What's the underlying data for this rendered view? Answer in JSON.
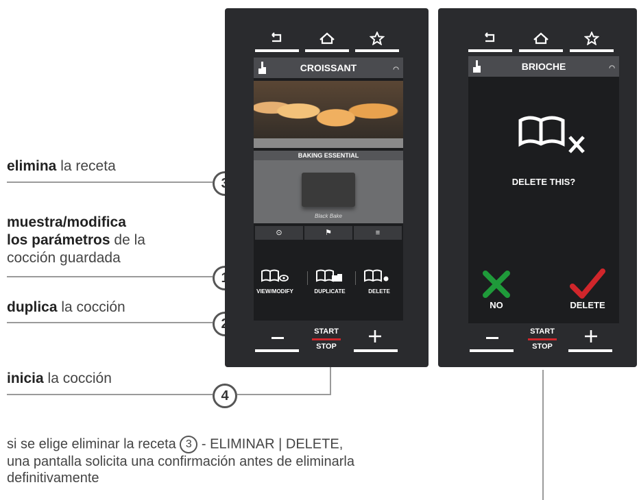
{
  "annotations": {
    "delete": {
      "bold": "elimina",
      "rest": " la receta",
      "num": "3"
    },
    "view": {
      "bold_lines": [
        "muestra/modifica",
        "los parámetros"
      ],
      "rest_line2": " de la",
      "line3": "cocción guardada",
      "num": "1"
    },
    "duplicate": {
      "bold": "duplica",
      "rest": " la cocción",
      "num": "2"
    },
    "start": {
      "bold": "inicia",
      "rest": " la cocción",
      "num": "4"
    }
  },
  "footnote": {
    "part1": "si se elige eliminar la receta",
    "num": "3",
    "part2": " - ELIMINAR | DELETE,",
    "line2": "una pantalla solicita una confirmación antes de eliminarla",
    "line3": "definitivamente"
  },
  "left_device": {
    "title": "CROISSANT",
    "section_label": "BAKING ESSENTIAL",
    "tray_logo": "Black Bake",
    "actions": [
      "VIEW/MODIFY",
      "DUPLICATE",
      "DELETE"
    ],
    "start_label": "START",
    "stop_label": "STOP"
  },
  "right_device": {
    "title": "BRIOCHE",
    "prompt": "DELETE THIS?",
    "no_label": "NO",
    "delete_label": "DELETE",
    "start_label": "START",
    "stop_label": "STOP"
  },
  "colors": {
    "device": "#2a2b2e",
    "confirm_red": "#d0262b",
    "cancel_green": "#1f9a3a"
  },
  "icons": [
    "back-icon",
    "home-icon",
    "star-icon",
    "hand-icon",
    "wifi-icon",
    "book-delete-icon",
    "x-cross-icon",
    "checkmark-icon",
    "minus-icon",
    "plus-icon"
  ]
}
